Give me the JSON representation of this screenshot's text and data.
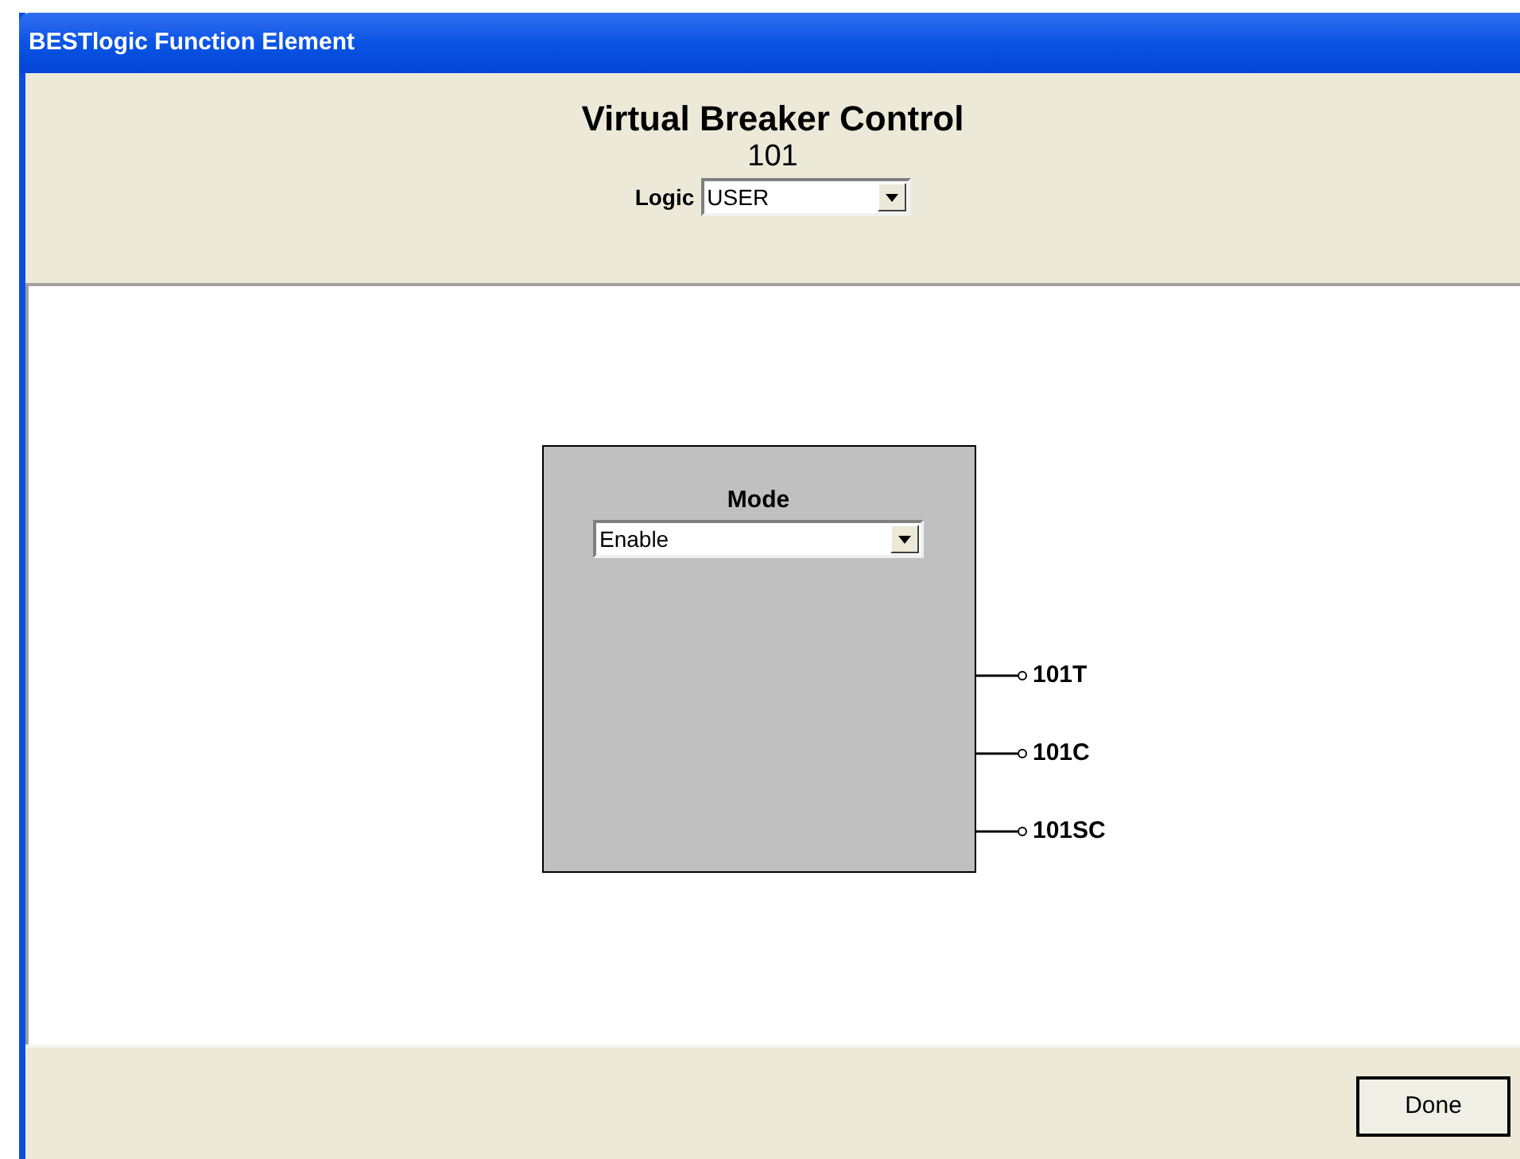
{
  "window": {
    "title": "BESTlogic Function Element"
  },
  "header": {
    "title": "Virtual Breaker Control",
    "number": "101",
    "logic": {
      "label": "Logic",
      "value": "USER"
    }
  },
  "element": {
    "mode": {
      "label": "Mode",
      "value": "Enable"
    },
    "outputs": [
      {
        "label": "101T"
      },
      {
        "label": "101C"
      },
      {
        "label": "101SC"
      }
    ]
  },
  "buttons": [
    {
      "label": "Done"
    }
  ]
}
